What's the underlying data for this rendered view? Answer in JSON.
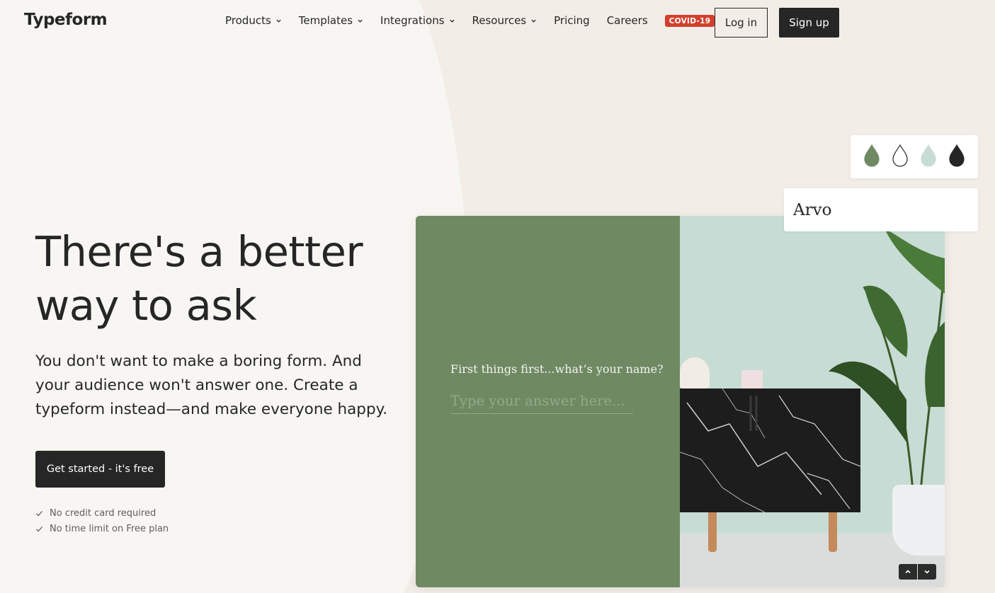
{
  "header": {
    "logo": "Typeform",
    "nav": [
      {
        "label": "Products",
        "dropdown": true
      },
      {
        "label": "Templates",
        "dropdown": true
      },
      {
        "label": "Integrations",
        "dropdown": true
      },
      {
        "label": "Resources",
        "dropdown": true
      },
      {
        "label": "Pricing",
        "dropdown": false
      },
      {
        "label": "Careers",
        "dropdown": false
      }
    ],
    "badge": "COVID-19",
    "login_label": "Log in",
    "signup_label": "Sign up"
  },
  "hero": {
    "title_line1": "There's a better",
    "title_line2": "way to ask",
    "subtitle": "You don't want to make a boring form. And your audience won't answer one. Create a typeform instead—and make everyone happy.",
    "cta_label": "Get started - it's free",
    "perks": [
      "No credit card required",
      "No time limit on Free plan"
    ]
  },
  "preview": {
    "question": "First things first...what’s your name?",
    "answer_placeholder": "Type your answer here...",
    "font_name": "Arvo",
    "swatch_colors": [
      "#6f8a63",
      "#ffffff",
      "#c7dcd4",
      "#262627"
    ]
  },
  "icons": {
    "nav_dropdown": "chevron-down-icon",
    "perk_check": "check-icon",
    "scroll_up": "chevron-up-icon",
    "scroll_down": "chevron-down-icon",
    "swatch": "droplet-icon"
  },
  "colors": {
    "background": "#f8f6f2",
    "text": "#262627",
    "accent_badge": "#d2402d",
    "preview_green": "#6f8a63",
    "preview_mint": "#c7dcd4"
  }
}
